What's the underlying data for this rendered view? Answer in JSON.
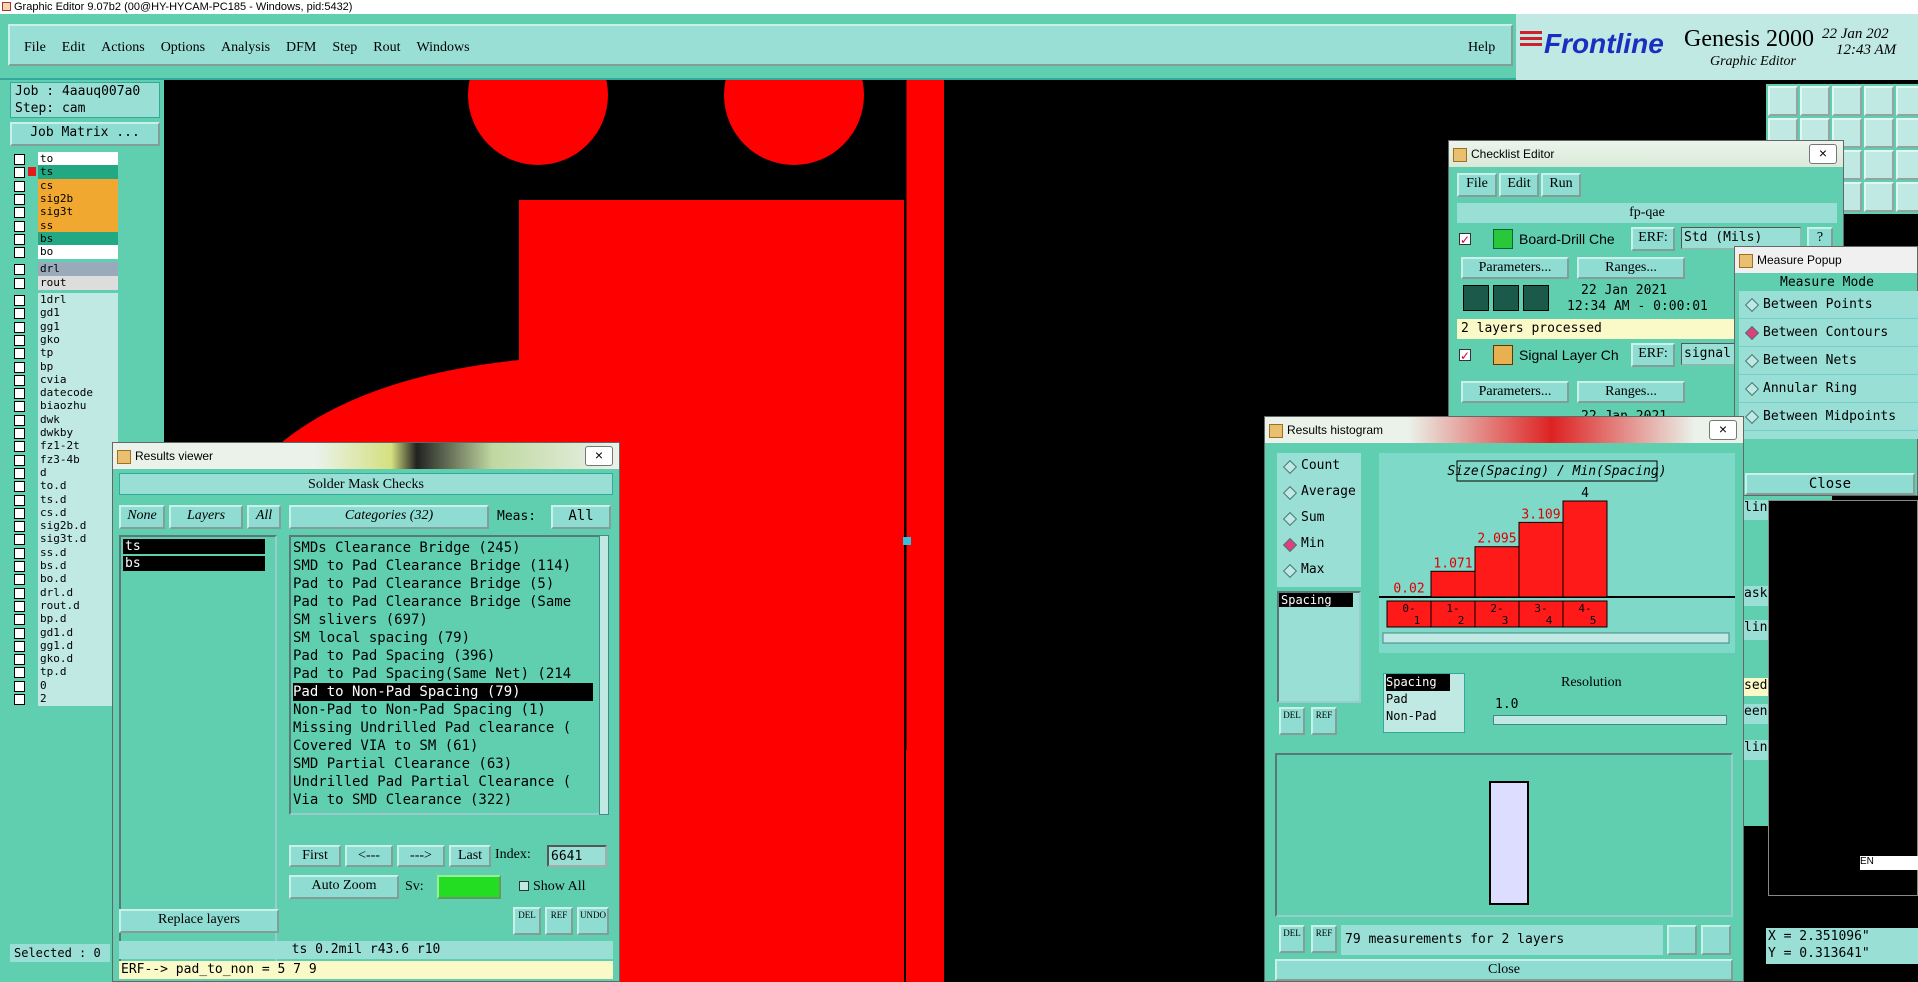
{
  "titlebar": {
    "title": "Graphic Editor 9.07b2 (00@HY-HYCAM-PC185 - Windows, pid:5432)"
  },
  "menu": [
    "File",
    "Edit",
    "Actions",
    "Options",
    "Analysis",
    "DFM",
    "Step",
    "Rout",
    "Windows"
  ],
  "help": "Help",
  "brand": {
    "logo": "Frontline",
    "product": "Genesis 2000",
    "subtitle": "Graphic Editor",
    "date": "22 Jan 202",
    "time": "12:43 AM"
  },
  "job": {
    "job": "Job : 4aauq007a0",
    "step": "Step: cam",
    "matrix": "Job Matrix ...",
    "selected": "Selected : 0"
  },
  "layers": [
    "to",
    "ts",
    "cs",
    "sig2b",
    "sig3t",
    "ss",
    "bs",
    "bo",
    "drl",
    "rout",
    "1drl",
    "gd1",
    "gg1",
    "gko",
    "tp",
    "bp",
    "cvia",
    "datecode",
    "biaozhu",
    "dwk",
    "dwkby",
    "fz1-2t",
    "fz3-4b",
    "d",
    "to.d",
    "ts.d",
    "cs.d",
    "sig2b.d",
    "sig3t.d",
    "ss.d",
    "bs.d",
    "bo.d",
    "drl.d",
    "rout.d",
    "bp.d",
    "gd1.d",
    "gg1.d",
    "gko.d",
    "tp.d",
    "0",
    "2"
  ],
  "results_viewer": {
    "title": "Results viewer",
    "header": "Solder Mask Checks",
    "none": "None",
    "layers": "Layers",
    "all": "All",
    "categories": "Categories (32)",
    "meas_label": "Meas:",
    "meas_value": "All",
    "layer_items": [
      "ts",
      "bs"
    ],
    "items": [
      "SMDs Clearance Bridge (245)",
      "SMD to Pad Clearance Bridge (114)",
      "Pad to Pad Clearance Bridge (5)",
      "Pad to Pad Clearance Bridge (Same",
      "SM slivers (697)",
      "SM local spacing (79)",
      "Pad to Pad Spacing (396)",
      "Pad to Pad Spacing(Same Net) (214",
      "Pad to Non-Pad Spacing (79)",
      "Non-Pad to Non-Pad Spacing (1)",
      "Missing Undrilled Pad clearance (",
      "Covered VIA to SM (61)",
      "SMD Partial Clearance (63)",
      "Undrilled Pad Partial Clearance (",
      "Via to SMD Clearance (322)"
    ],
    "selected_index": 8,
    "first": "First",
    "prev": "<---",
    "next": "--->",
    "last": "Last",
    "index_label": "Index:",
    "index_value": "6641",
    "auto_zoom": "Auto Zoom",
    "sv": "Sv:",
    "show_all": "Show All",
    "replace": "Replace layers",
    "del": "DEL",
    "ref": "REF",
    "undo": "UNDO",
    "status": "ts 0.2mil  r43.6  r10",
    "erf": "ERF--> pad_to_non = 5 7 9"
  },
  "checklist": {
    "title": "Checklist Editor",
    "menu": [
      "File",
      "Edit",
      "Run"
    ],
    "name": "fp-qae",
    "check1": "Board-Drill Che",
    "erf": "ERF:",
    "std": "Std (Mils)",
    "params": "Parameters...",
    "ranges": "Ranges...",
    "date": "22 Jan 2021",
    "time": "12:34 AM - 0:00:01",
    "processed": "2 layers processed",
    "check2": "Signal Layer Ch",
    "signal": "signal",
    "date2": "22 Jan 2021"
  },
  "measure": {
    "title": "Measure Popup",
    "mode": "Measure Mode",
    "options": [
      "Between Points",
      "Between Contours",
      "Between Nets",
      "Annular Ring",
      "Between Midpoints"
    ],
    "selected": 1,
    "close": "Close"
  },
  "histogram": {
    "title": "Results histogram",
    "stats": [
      "Count",
      "Average",
      "Sum",
      "Min",
      "Max"
    ],
    "selected_stat": 3,
    "chart_title": "Size(Spacing) / Min(Spacing)",
    "list_item": "Spacing",
    "resolution_label": "Resolution",
    "resolution_value": "1.0",
    "types": [
      "Spacing",
      "Pad",
      "Non-Pad"
    ],
    "summary": "79 measurements for 2 layers",
    "close": "Close",
    "del": "DEL",
    "ref": "REF"
  },
  "chart_data": {
    "type": "bar",
    "categories": [
      "0-1",
      "1-2",
      "2-3",
      "3-4",
      "4-5"
    ],
    "values": [
      0.02,
      1.071,
      2.095,
      3.109,
      4
    ],
    "labels": [
      "0.02",
      "1.071",
      "2.095",
      "3.109",
      "4"
    ],
    "title": "Size(Spacing) / Min(Spacing)",
    "ylim": [
      0,
      4
    ]
  },
  "right_frag": {
    "line1": "line...",
    "line2": "line...",
    "line3": "line...",
    "ask": "ask",
    "sed": "sed",
    "een": "een",
    "en": "EN"
  },
  "coords": {
    "x": "X = 2.351096\"",
    "y": "Y = 0.313641\""
  },
  "colors": {
    "teal": "#5fcfb0",
    "light": "#9adfd6",
    "canvas": "#000000",
    "copper": "#ff0000"
  }
}
